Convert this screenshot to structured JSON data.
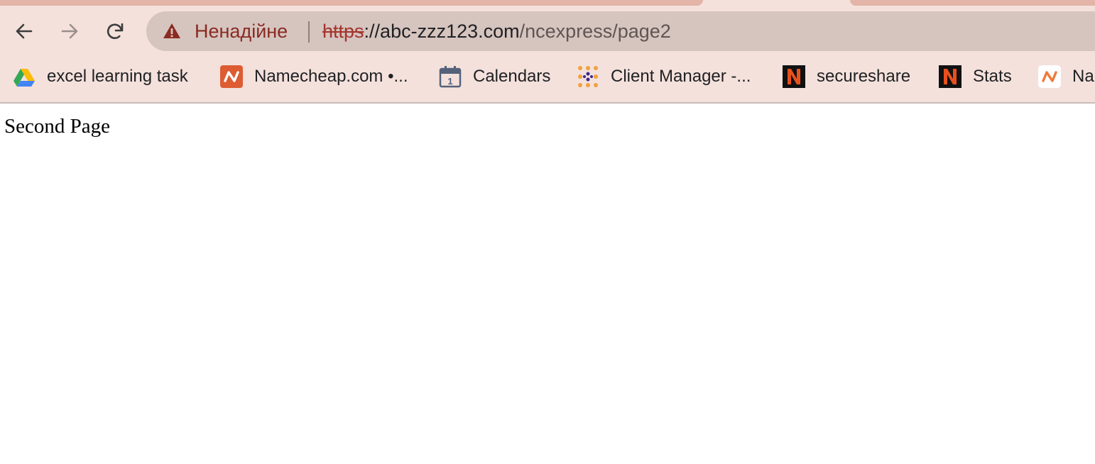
{
  "browser": {
    "security_label": "Ненадійне",
    "url": {
      "scheme": "https",
      "host_part": "://abc-zzz123.com",
      "path": "/ncexpress/page2"
    },
    "bookmarks": [
      {
        "label": "excel learning task",
        "icon": "google-drive-icon"
      },
      {
        "label": "Namecheap.com •...",
        "icon": "namecheap-icon"
      },
      {
        "label": "Calendars",
        "icon": "calendar-icon"
      },
      {
        "label": "Client Manager -...",
        "icon": "client-manager-icon"
      },
      {
        "label": "secureshare",
        "icon": "n-logo-icon"
      },
      {
        "label": "Stats",
        "icon": "n-logo-icon"
      },
      {
        "label": "Na",
        "icon": "namecheap-icon"
      }
    ],
    "colors": {
      "chrome_bg": "#f4e1dc",
      "tab_accent": "#e3b4a7",
      "omnibox_bg": "#d6c4bf",
      "warning_red": "#8a2b22"
    }
  },
  "page": {
    "text": "Second Page"
  }
}
